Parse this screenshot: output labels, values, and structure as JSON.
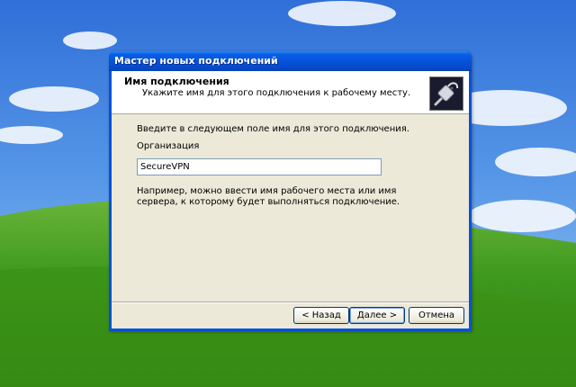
{
  "window": {
    "title": "Мастер новых подключений"
  },
  "header": {
    "title": "Имя подключения",
    "subtitle": "Укажите имя для этого подключения к рабочему месту."
  },
  "form": {
    "instruction": "Введите в следующем поле имя для этого подключения.",
    "field_label": "Организация",
    "field_value": "SecureVPN",
    "example": "Например, можно ввести имя рабочего места или имя сервера, к которому будет выполняться подключение."
  },
  "buttons": {
    "back": "< Назад",
    "next": "Далее >",
    "cancel": "Отмена"
  },
  "icons": {
    "header": "network-cable-icon"
  },
  "colors": {
    "titlebar": "#0552d9",
    "client_bg": "#ece9d8",
    "input_border": "#7f9db9"
  }
}
